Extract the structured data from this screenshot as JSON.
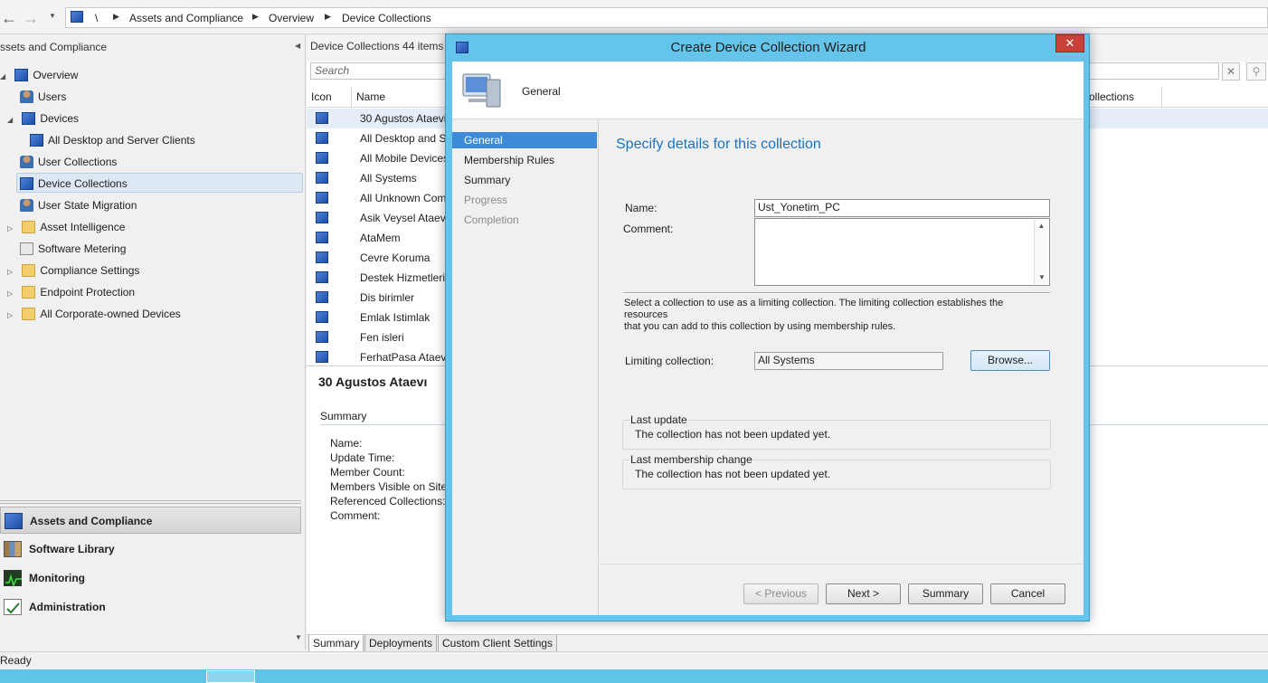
{
  "breadcrumb": {
    "root": "\\",
    "items": [
      "Assets and Compliance",
      "Overview",
      "Device Collections"
    ]
  },
  "navigation": {
    "title": "ssets and Compliance",
    "tree": [
      {
        "label": "Overview",
        "icon": "overview-icon"
      },
      {
        "label": "Users",
        "icon": "user-icon"
      },
      {
        "label": "Devices",
        "icon": "devices-icon"
      },
      {
        "label": "All Desktop and Server Clients",
        "icon": "collection-icon"
      },
      {
        "label": "User Collections",
        "icon": "user-collection-icon"
      },
      {
        "label": "Device Collections",
        "icon": "device-collection-icon",
        "selected": true
      },
      {
        "label": "User State Migration",
        "icon": "migration-icon"
      },
      {
        "label": "Asset Intelligence",
        "icon": "folder-icon"
      },
      {
        "label": "Software Metering",
        "icon": "metering-icon"
      },
      {
        "label": "Compliance Settings",
        "icon": "folder-icon"
      },
      {
        "label": "Endpoint Protection",
        "icon": "folder-icon"
      },
      {
        "label": "All Corporate-owned Devices",
        "icon": "folder-icon"
      }
    ],
    "workspaces": [
      "Assets and Compliance",
      "Software Library",
      "Monitoring",
      "Administration"
    ]
  },
  "list": {
    "title": "Device Collections 44 items",
    "search_placeholder": "Search",
    "columns": [
      "Icon",
      "Name",
      "ollections"
    ],
    "rows": [
      "30 Agustos Ataevi",
      "All Desktop and S",
      "All Mobile Devices",
      "All Systems",
      "All Unknown Com",
      "Asik Veysel  Ataev",
      "AtaMem",
      "Cevre Koruma",
      "Destek Hizmetleri",
      "Dis birimler",
      "Emlak Istimlak",
      "Fen isleri",
      "FerhatPasa Ataevi"
    ]
  },
  "detail": {
    "title": "30 Agustos Ataevı",
    "section": "Summary",
    "fields": [
      "Name:",
      "Update Time:",
      "Member Count:",
      "Members Visible on Site",
      "Referenced Collections:",
      "Comment:"
    ]
  },
  "bottom_tabs": [
    "Summary",
    "Deployments",
    "Custom Client Settings"
  ],
  "status": "Ready",
  "wizard": {
    "title": "Create Device Collection Wizard",
    "header_label": "General",
    "steps": [
      {
        "label": "General",
        "state": "active"
      },
      {
        "label": "Membership Rules",
        "state": "normal"
      },
      {
        "label": "Summary",
        "state": "normal"
      },
      {
        "label": "Progress",
        "state": "disabled"
      },
      {
        "label": "Completion",
        "state": "disabled"
      }
    ],
    "heading": "Specify details for this collection",
    "name_label": "Name:",
    "name_value": "Ust_Yonetim_PC",
    "comment_label": "Comment:",
    "comment_value": "",
    "limiting_help_line1": "Select a collection to use as a limiting collection. The limiting collection establishes the resources",
    "limiting_help_line2": "that you can add to this collection by using membership rules.",
    "limiting_label": "Limiting collection:",
    "limiting_value": "All Systems",
    "browse_label": "Browse...",
    "last_update_label": "Last update",
    "last_update_value": "The collection has not been updated yet.",
    "last_membership_label": "Last membership change",
    "last_membership_value": "The collection has not been updated yet.",
    "buttons": {
      "previous": "< Previous",
      "next": "Next >",
      "summary": "Summary",
      "cancel": "Cancel"
    },
    "close_glyph": "✕"
  },
  "colors": {
    "dialog_frame": "#64c4e9",
    "step_active": "#3c8ad8",
    "heading_blue": "#1a73c2",
    "close_red": "#c7403a"
  }
}
